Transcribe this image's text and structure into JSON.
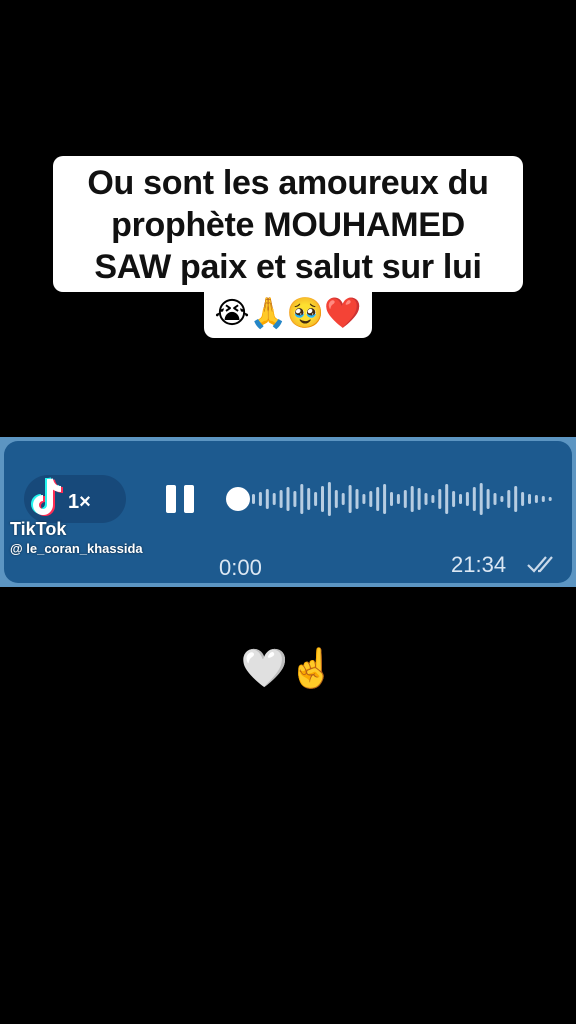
{
  "caption": {
    "lines": [
      "Ou sont les amoureux du",
      "prophète MOUHAMED",
      "SAW paix et salut sur lui"
    ],
    "emoji": "😭🙏🥹❤️"
  },
  "voice_message": {
    "speed": "1×",
    "elapsed": "0:00",
    "sent_time": "21:34",
    "state": "playing",
    "progress": 0.0,
    "icons": [
      "tiktok-icon",
      "pause-icon",
      "double-check-icon"
    ]
  },
  "watermark": {
    "app_name": "TikTok",
    "handle": "@ le_coran_khassida"
  },
  "reply": {
    "emoji": "🤍☝️"
  },
  "colors": {
    "background": "#000000",
    "bubble": "#1d5a8f",
    "bubble_border": "#5c95c2",
    "caption_bg": "#ffffff"
  }
}
